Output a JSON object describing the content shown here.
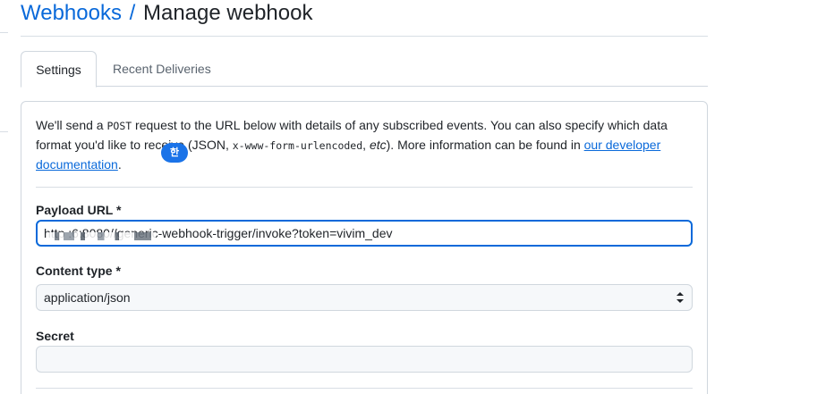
{
  "breadcrumb": {
    "parent": "Webhooks",
    "separator": "/",
    "current": "Manage webhook"
  },
  "tabs": [
    {
      "label": "Settings",
      "active": true
    },
    {
      "label": "Recent Deliveries",
      "active": false
    }
  ],
  "intro": {
    "part1": "We'll send a ",
    "code1": "POST",
    "part2": " request to the URL below with details of any subscribed events. You can also specify which data format you'd like to receive (JSON, ",
    "code2": "x-www-form-urlencoded",
    "part3": ", ",
    "em1": "etc",
    "part4": "). More information can be found in ",
    "link": "our developer documentation",
    "part5": "."
  },
  "form": {
    "payload_url_label": "Payload URL *",
    "payload_url_value": "http          :6:8080//generic-webhook-trigger/invoke?token=vivim_dev",
    "ime_indicator": "한",
    "content_type_label": "Content type *",
    "content_type_value": "application/json",
    "secret_label": "Secret",
    "secret_value": ""
  },
  "colors": {
    "accent": "#0969da",
    "ime_badge": "#1a73e8",
    "border": "#d0d7de"
  }
}
